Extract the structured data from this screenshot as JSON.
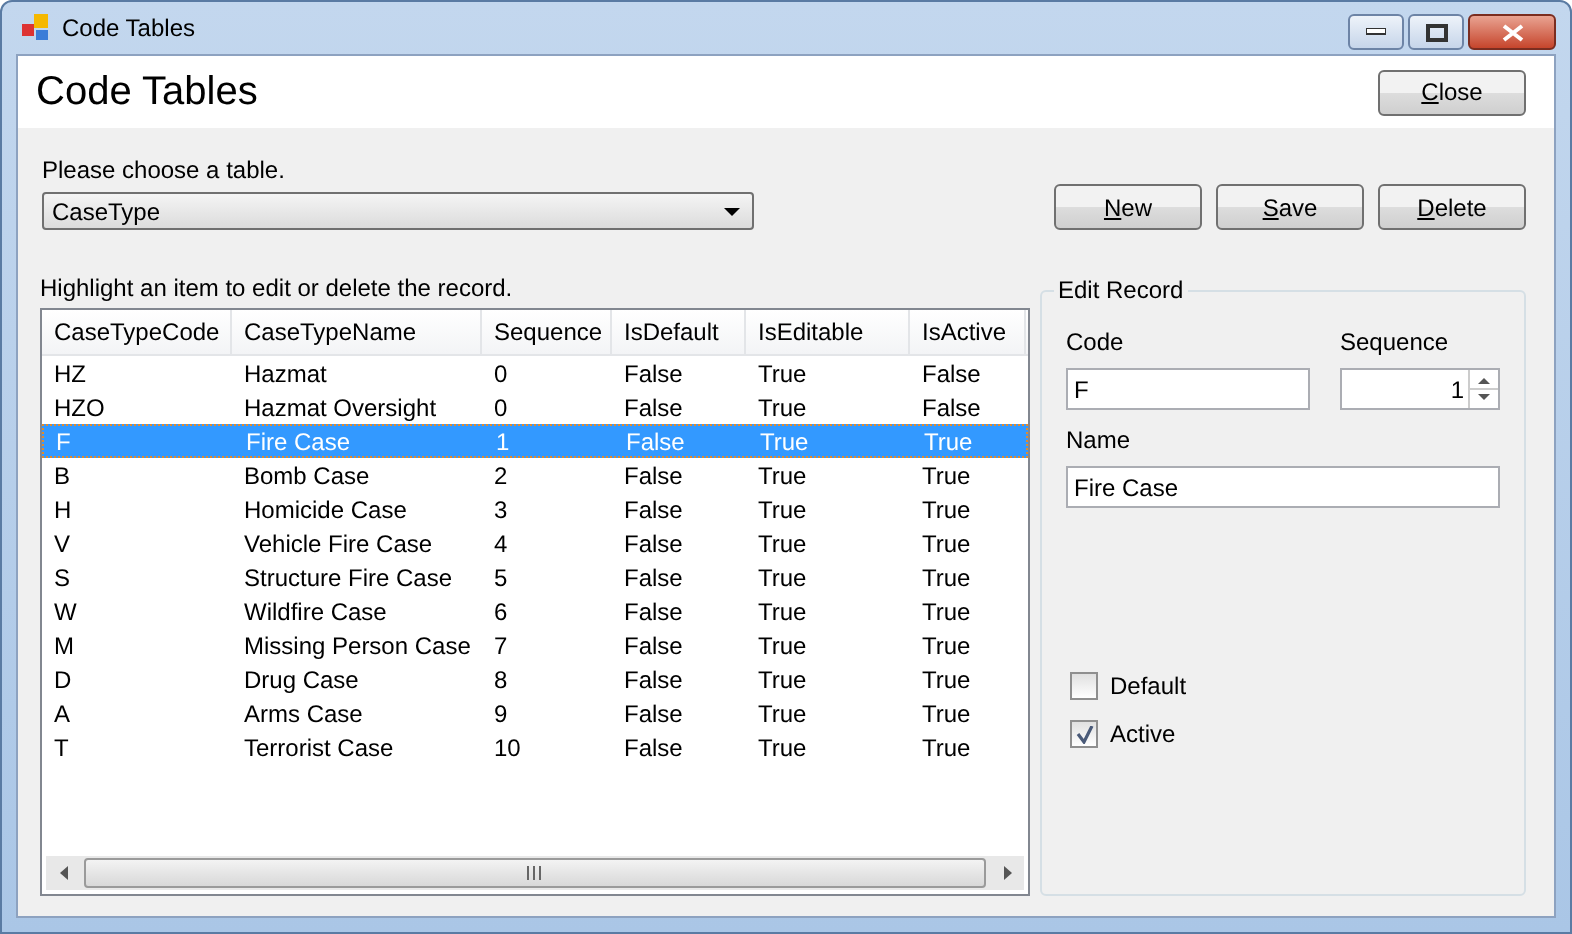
{
  "window": {
    "title": "Code Tables"
  },
  "header": {
    "title": "Code Tables",
    "close_button": "Close"
  },
  "table_chooser": {
    "label": "Please choose a table.",
    "value": "CaseType"
  },
  "buttons": [
    "New",
    "Save",
    "Delete"
  ],
  "list": {
    "hint": "Highlight an item to edit or delete the record.",
    "columns": [
      "CaseTypeCode",
      "CaseTypeName",
      "Sequence",
      "IsDefault",
      "IsEditable",
      "IsActive"
    ],
    "rows": [
      {
        "cells": [
          "HZ",
          "Hazmat",
          "0",
          "False",
          "True",
          "False"
        ],
        "selected": false
      },
      {
        "cells": [
          "HZO",
          "Hazmat Oversight",
          "0",
          "False",
          "True",
          "False"
        ],
        "selected": false
      },
      {
        "cells": [
          "F",
          "Fire Case",
          "1",
          "False",
          "True",
          "True"
        ],
        "selected": true
      },
      {
        "cells": [
          "B",
          "Bomb Case",
          "2",
          "False",
          "True",
          "True"
        ],
        "selected": false
      },
      {
        "cells": [
          "H",
          "Homicide Case",
          "3",
          "False",
          "True",
          "True"
        ],
        "selected": false
      },
      {
        "cells": [
          "V",
          "Vehicle Fire Case",
          "4",
          "False",
          "True",
          "True"
        ],
        "selected": false
      },
      {
        "cells": [
          "S",
          "Structure Fire Case",
          "5",
          "False",
          "True",
          "True"
        ],
        "selected": false
      },
      {
        "cells": [
          "W",
          "Wildfire Case",
          "6",
          "False",
          "True",
          "True"
        ],
        "selected": false
      },
      {
        "cells": [
          "M",
          "Missing Person Case",
          "7",
          "False",
          "True",
          "True"
        ],
        "selected": false
      },
      {
        "cells": [
          "D",
          "Drug Case",
          "8",
          "False",
          "True",
          "True"
        ],
        "selected": false
      },
      {
        "cells": [
          "A",
          "Arms Case",
          "9",
          "False",
          "True",
          "True"
        ],
        "selected": false
      },
      {
        "cells": [
          "T",
          "Terrorist Case",
          "10",
          "False",
          "True",
          "True"
        ],
        "selected": false
      }
    ]
  },
  "edit_record": {
    "title": "Edit Record",
    "code_label": "Code",
    "code_value": "F",
    "sequence_label": "Sequence",
    "sequence_value": "1",
    "name_label": "Name",
    "name_value": "Fire Case",
    "checkboxes": [
      {
        "label": "Default",
        "checked": false
      },
      {
        "label": "Active",
        "checked": true
      }
    ]
  }
}
